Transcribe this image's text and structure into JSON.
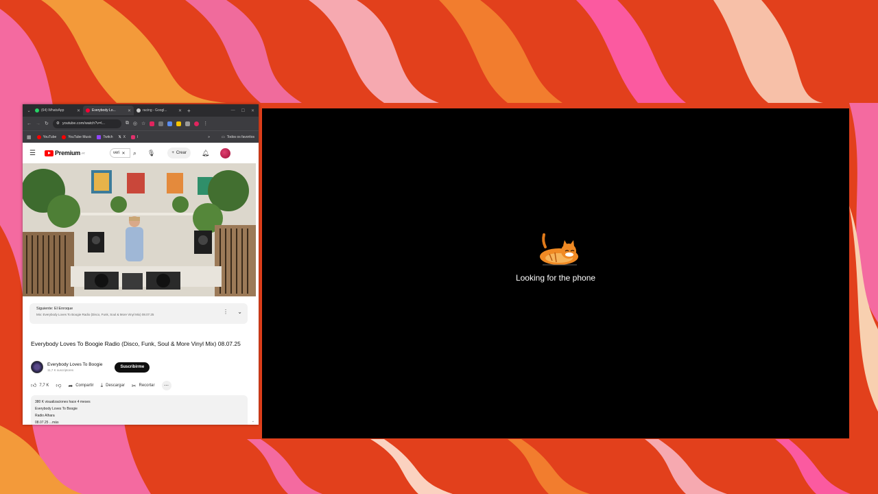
{
  "browser": {
    "tabs": [
      {
        "label": "(64) WhatsApp",
        "color": "#25d366"
      },
      {
        "label": "Everybody Lo...",
        "color": "#ff0033"
      },
      {
        "label": "racing - Googl...",
        "color": "#cccccc"
      }
    ],
    "url": "youtube.com/watch?v=l...",
    "bookmarks": [
      "YouTube",
      "YouTube Music",
      "Twitch",
      "X",
      "I"
    ],
    "bookmarks_right": "Todos os favoritos"
  },
  "youtube": {
    "logo": "Premium",
    "search_value": "veri",
    "create": "Crear",
    "next": {
      "label": "Siguiente:",
      "channel": "El Enroque",
      "subtitle": "Mix: Everybody Loves To Boogie Radio (Disco, Funk, Soul & More Vinyl Mix) 08.07.25"
    },
    "title": "Everybody Loves To Boogie Radio (Disco, Funk, Soul & More Vinyl Mix) 08.07.25",
    "channel": {
      "name": "Everybody Loves To Boogie",
      "subs": "11,7 K suscriptores"
    },
    "subscribe": "Suscribirme",
    "actions": {
      "likes": "7,7 K",
      "share": "Compartir",
      "download": "Descargar",
      "clip": "Recortar"
    },
    "description": {
      "line1": "380 K visualizaciones  hace 4 meses",
      "line2": "Everybody Loves To Boogie",
      "line3": "Radio Alhara",
      "line4": "08.07.25 ...más"
    }
  },
  "phone": {
    "message": "Looking for the phone"
  },
  "colors": {
    "yt_red": "#ff0000",
    "background_orange": "#e2401c"
  }
}
